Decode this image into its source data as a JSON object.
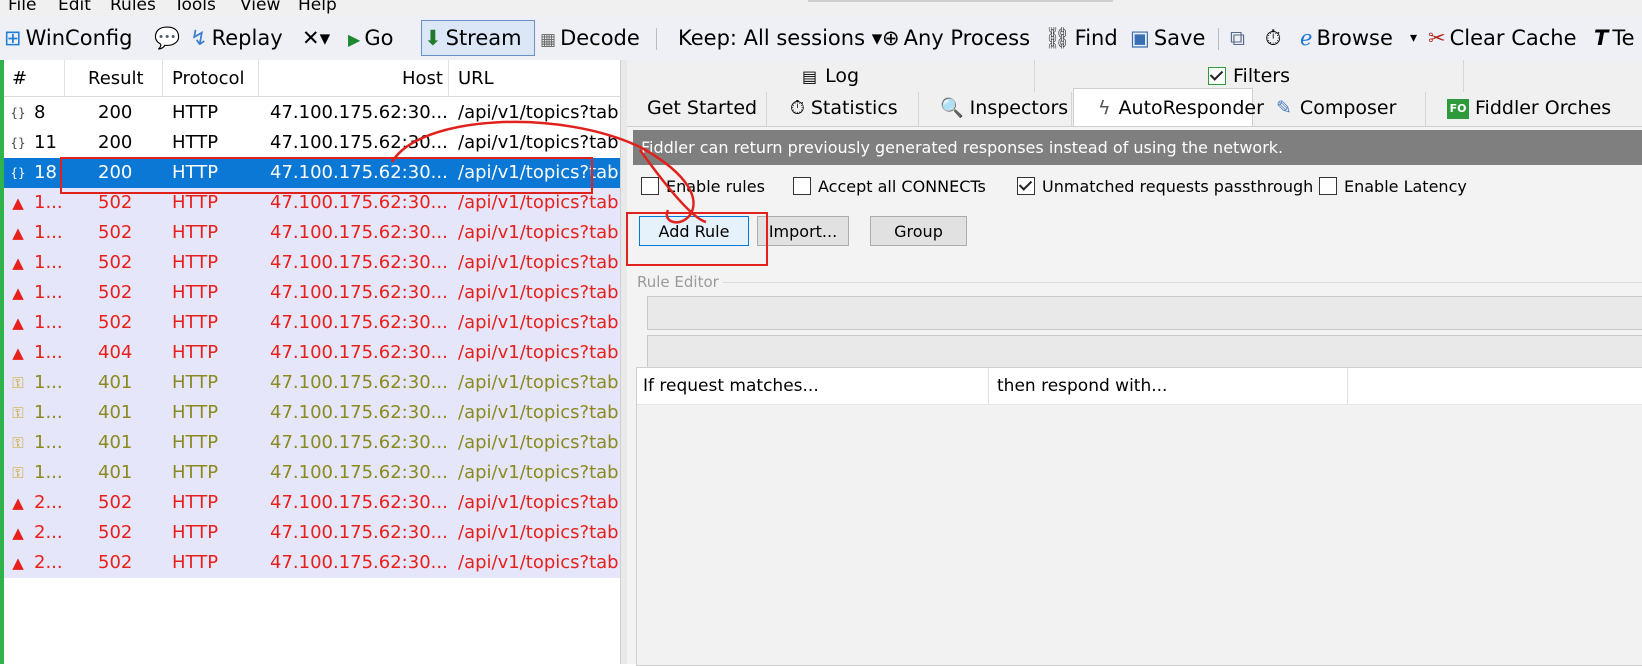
{
  "menu": {
    "items": [
      "File",
      "Edit",
      "Rules",
      "Tools",
      "View",
      "Help"
    ]
  },
  "toolbar": {
    "winconfig": "WinConfig",
    "replay": "Replay",
    "remove": "✕▾",
    "go": "Go",
    "stream": "Stream",
    "decode": "Decode",
    "keep": "Keep: All sessions ▾",
    "any_process": "Any Process",
    "find": "Find",
    "save": "Save",
    "browse": "Browse",
    "browse_drop": "▾",
    "clear_cache": "Clear Cache",
    "text_wizard": "Te"
  },
  "grid": {
    "columns": {
      "num": "#",
      "result": "Result",
      "protocol": "Protocol",
      "host": "Host",
      "url": "URL"
    },
    "rows": [
      {
        "num": "8",
        "result": "200",
        "protocol": "HTTP",
        "host": "47.100.175.62:30...",
        "url": "/api/v1/topics?tab=",
        "kind": "ok",
        "icon": "json-icon",
        "glyph": "{}"
      },
      {
        "num": "11",
        "result": "200",
        "protocol": "HTTP",
        "host": "47.100.175.62:30...",
        "url": "/api/v1/topics?tab=",
        "kind": "ok",
        "icon": "json-icon",
        "glyph": "{}"
      },
      {
        "num": "18",
        "result": "200",
        "protocol": "HTTP",
        "host": "47.100.175.62:30...",
        "url": "/api/v1/topics?tab=",
        "kind": "sel",
        "icon": "json-icon",
        "glyph": "{}"
      },
      {
        "num": "1...",
        "result": "502",
        "protocol": "HTTP",
        "host": "47.100.175.62:30...",
        "url": "/api/v1/topics?tab=",
        "kind": "err",
        "icon": "warning-icon",
        "glyph": "▲"
      },
      {
        "num": "1...",
        "result": "502",
        "protocol": "HTTP",
        "host": "47.100.175.62:30...",
        "url": "/api/v1/topics?tab=",
        "kind": "err",
        "icon": "warning-icon",
        "glyph": "▲"
      },
      {
        "num": "1...",
        "result": "502",
        "protocol": "HTTP",
        "host": "47.100.175.62:30...",
        "url": "/api/v1/topics?tab=",
        "kind": "err",
        "icon": "warning-icon",
        "glyph": "▲"
      },
      {
        "num": "1...",
        "result": "502",
        "protocol": "HTTP",
        "host": "47.100.175.62:30...",
        "url": "/api/v1/topics?tab=",
        "kind": "err",
        "icon": "warning-icon",
        "glyph": "▲"
      },
      {
        "num": "1...",
        "result": "502",
        "protocol": "HTTP",
        "host": "47.100.175.62:30...",
        "url": "/api/v1/topics?tab=",
        "kind": "err",
        "icon": "warning-icon",
        "glyph": "▲"
      },
      {
        "num": "1...",
        "result": "404",
        "protocol": "HTTP",
        "host": "47.100.175.62:30...",
        "url": "/api/v1/topics?tab=",
        "kind": "err",
        "icon": "warning-icon",
        "glyph": "▲"
      },
      {
        "num": "1...",
        "result": "401",
        "protocol": "HTTP",
        "host": "47.100.175.62:30...",
        "url": "/api/v1/topics?tab=",
        "kind": "auth",
        "icon": "key-icon",
        "glyph": "⚿"
      },
      {
        "num": "1...",
        "result": "401",
        "protocol": "HTTP",
        "host": "47.100.175.62:30...",
        "url": "/api/v1/topics?tab=",
        "kind": "auth",
        "icon": "key-icon",
        "glyph": "⚿"
      },
      {
        "num": "1...",
        "result": "401",
        "protocol": "HTTP",
        "host": "47.100.175.62:30...",
        "url": "/api/v1/topics?tab=",
        "kind": "auth",
        "icon": "key-icon",
        "glyph": "⚿"
      },
      {
        "num": "1...",
        "result": "401",
        "protocol": "HTTP",
        "host": "47.100.175.62:30...",
        "url": "/api/v1/topics?tab=",
        "kind": "auth",
        "icon": "key-icon",
        "glyph": "⚿"
      },
      {
        "num": "2...",
        "result": "502",
        "protocol": "HTTP",
        "host": "47.100.175.62:30...",
        "url": "/api/v1/topics?tab=",
        "kind": "err",
        "icon": "warning-icon",
        "glyph": "▲"
      },
      {
        "num": "2...",
        "result": "502",
        "protocol": "HTTP",
        "host": "47.100.175.62:30...",
        "url": "/api/v1/topics?tab=",
        "kind": "err",
        "icon": "warning-icon",
        "glyph": "▲"
      },
      {
        "num": "2...",
        "result": "502",
        "protocol": "HTTP",
        "host": "47.100.175.62:30...",
        "url": "/api/v1/topics?tab=",
        "kind": "err",
        "icon": "warning-icon",
        "glyph": "▲"
      }
    ]
  },
  "tabs_top": {
    "log": "Log",
    "filters": "Filters"
  },
  "tabs_main": {
    "get_started": "Get Started",
    "statistics": "Statistics",
    "inspectors": "Inspectors",
    "autoresponder": "AutoResponder",
    "composer": "Composer",
    "fo_badge": "FO",
    "orchestra": "Fiddler Orches"
  },
  "autoresponder": {
    "info": "Fiddler can return previously generated responses instead of using the network.",
    "enable_rules": {
      "label": "Enable rules",
      "checked": false
    },
    "accept_connects": {
      "label": "Accept all CONNECTs",
      "checked": false
    },
    "unmatched_passthrough": {
      "label": "Unmatched requests passthrough",
      "checked": true
    },
    "enable_latency": {
      "label": "Enable Latency",
      "checked": false
    },
    "add_rule": "Add Rule",
    "import": "Import...",
    "group": "Group",
    "rule_editor_legend": "Rule Editor",
    "list_col_match": "If request matches...",
    "list_col_respond": "then respond with..."
  },
  "colors": {
    "selected_row": "#0a78d4",
    "error_text": "#e8201c",
    "auth_text": "#8a8a20",
    "annotation_red": "#e0211c"
  }
}
